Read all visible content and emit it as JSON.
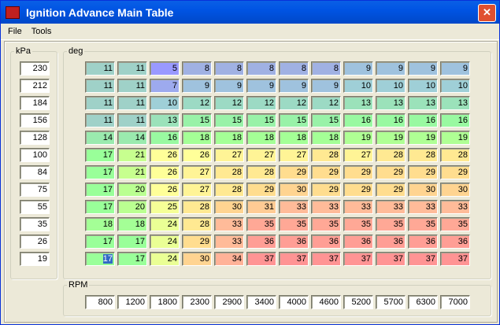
{
  "window": {
    "title": "Ignition Advance Main Table",
    "close_label": "✕"
  },
  "menu": [
    "File",
    "Tools"
  ],
  "kpa_group": {
    "label": "kPa",
    "values": [
      "230",
      "212",
      "184",
      "156",
      "128",
      "100",
      "84",
      "75",
      "55",
      "35",
      "26",
      "19"
    ]
  },
  "deg_group": {
    "label": "deg",
    "rows": [
      [
        "11",
        "11",
        "5",
        "8",
        "8",
        "8",
        "8",
        "8",
        "9",
        "9",
        "9",
        "9"
      ],
      [
        "11",
        "11",
        "7",
        "9",
        "9",
        "9",
        "9",
        "9",
        "10",
        "10",
        "10",
        "10"
      ],
      [
        "11",
        "11",
        "10",
        "12",
        "12",
        "12",
        "12",
        "12",
        "13",
        "13",
        "13",
        "13"
      ],
      [
        "11",
        "11",
        "13",
        "15",
        "15",
        "15",
        "15",
        "15",
        "16",
        "16",
        "16",
        "16"
      ],
      [
        "14",
        "14",
        "16",
        "18",
        "18",
        "18",
        "18",
        "18",
        "19",
        "19",
        "19",
        "19"
      ],
      [
        "17",
        "21",
        "26",
        "26",
        "27",
        "27",
        "27",
        "28",
        "27",
        "28",
        "28",
        "28"
      ],
      [
        "17",
        "21",
        "26",
        "27",
        "28",
        "28",
        "29",
        "29",
        "29",
        "29",
        "29",
        "29"
      ],
      [
        "17",
        "20",
        "26",
        "27",
        "28",
        "29",
        "30",
        "29",
        "29",
        "29",
        "30",
        "30"
      ],
      [
        "17",
        "20",
        "25",
        "28",
        "30",
        "31",
        "33",
        "33",
        "33",
        "33",
        "33",
        "33"
      ],
      [
        "18",
        "18",
        "24",
        "28",
        "33",
        "35",
        "35",
        "35",
        "35",
        "35",
        "35",
        "35"
      ],
      [
        "17",
        "17",
        "24",
        "29",
        "33",
        "36",
        "36",
        "36",
        "36",
        "36",
        "36",
        "36"
      ],
      [
        "17",
        "17",
        "24",
        "30",
        "34",
        "37",
        "37",
        "37",
        "37",
        "37",
        "37",
        "37"
      ]
    ]
  },
  "rpm_group": {
    "label": "RPM",
    "values": [
      "800",
      "1200",
      "1800",
      "2300",
      "2900",
      "3400",
      "4000",
      "4600",
      "5200",
      "5700",
      "6300",
      "7000"
    ]
  },
  "selected_cell": {
    "row": 11,
    "col": 0
  }
}
